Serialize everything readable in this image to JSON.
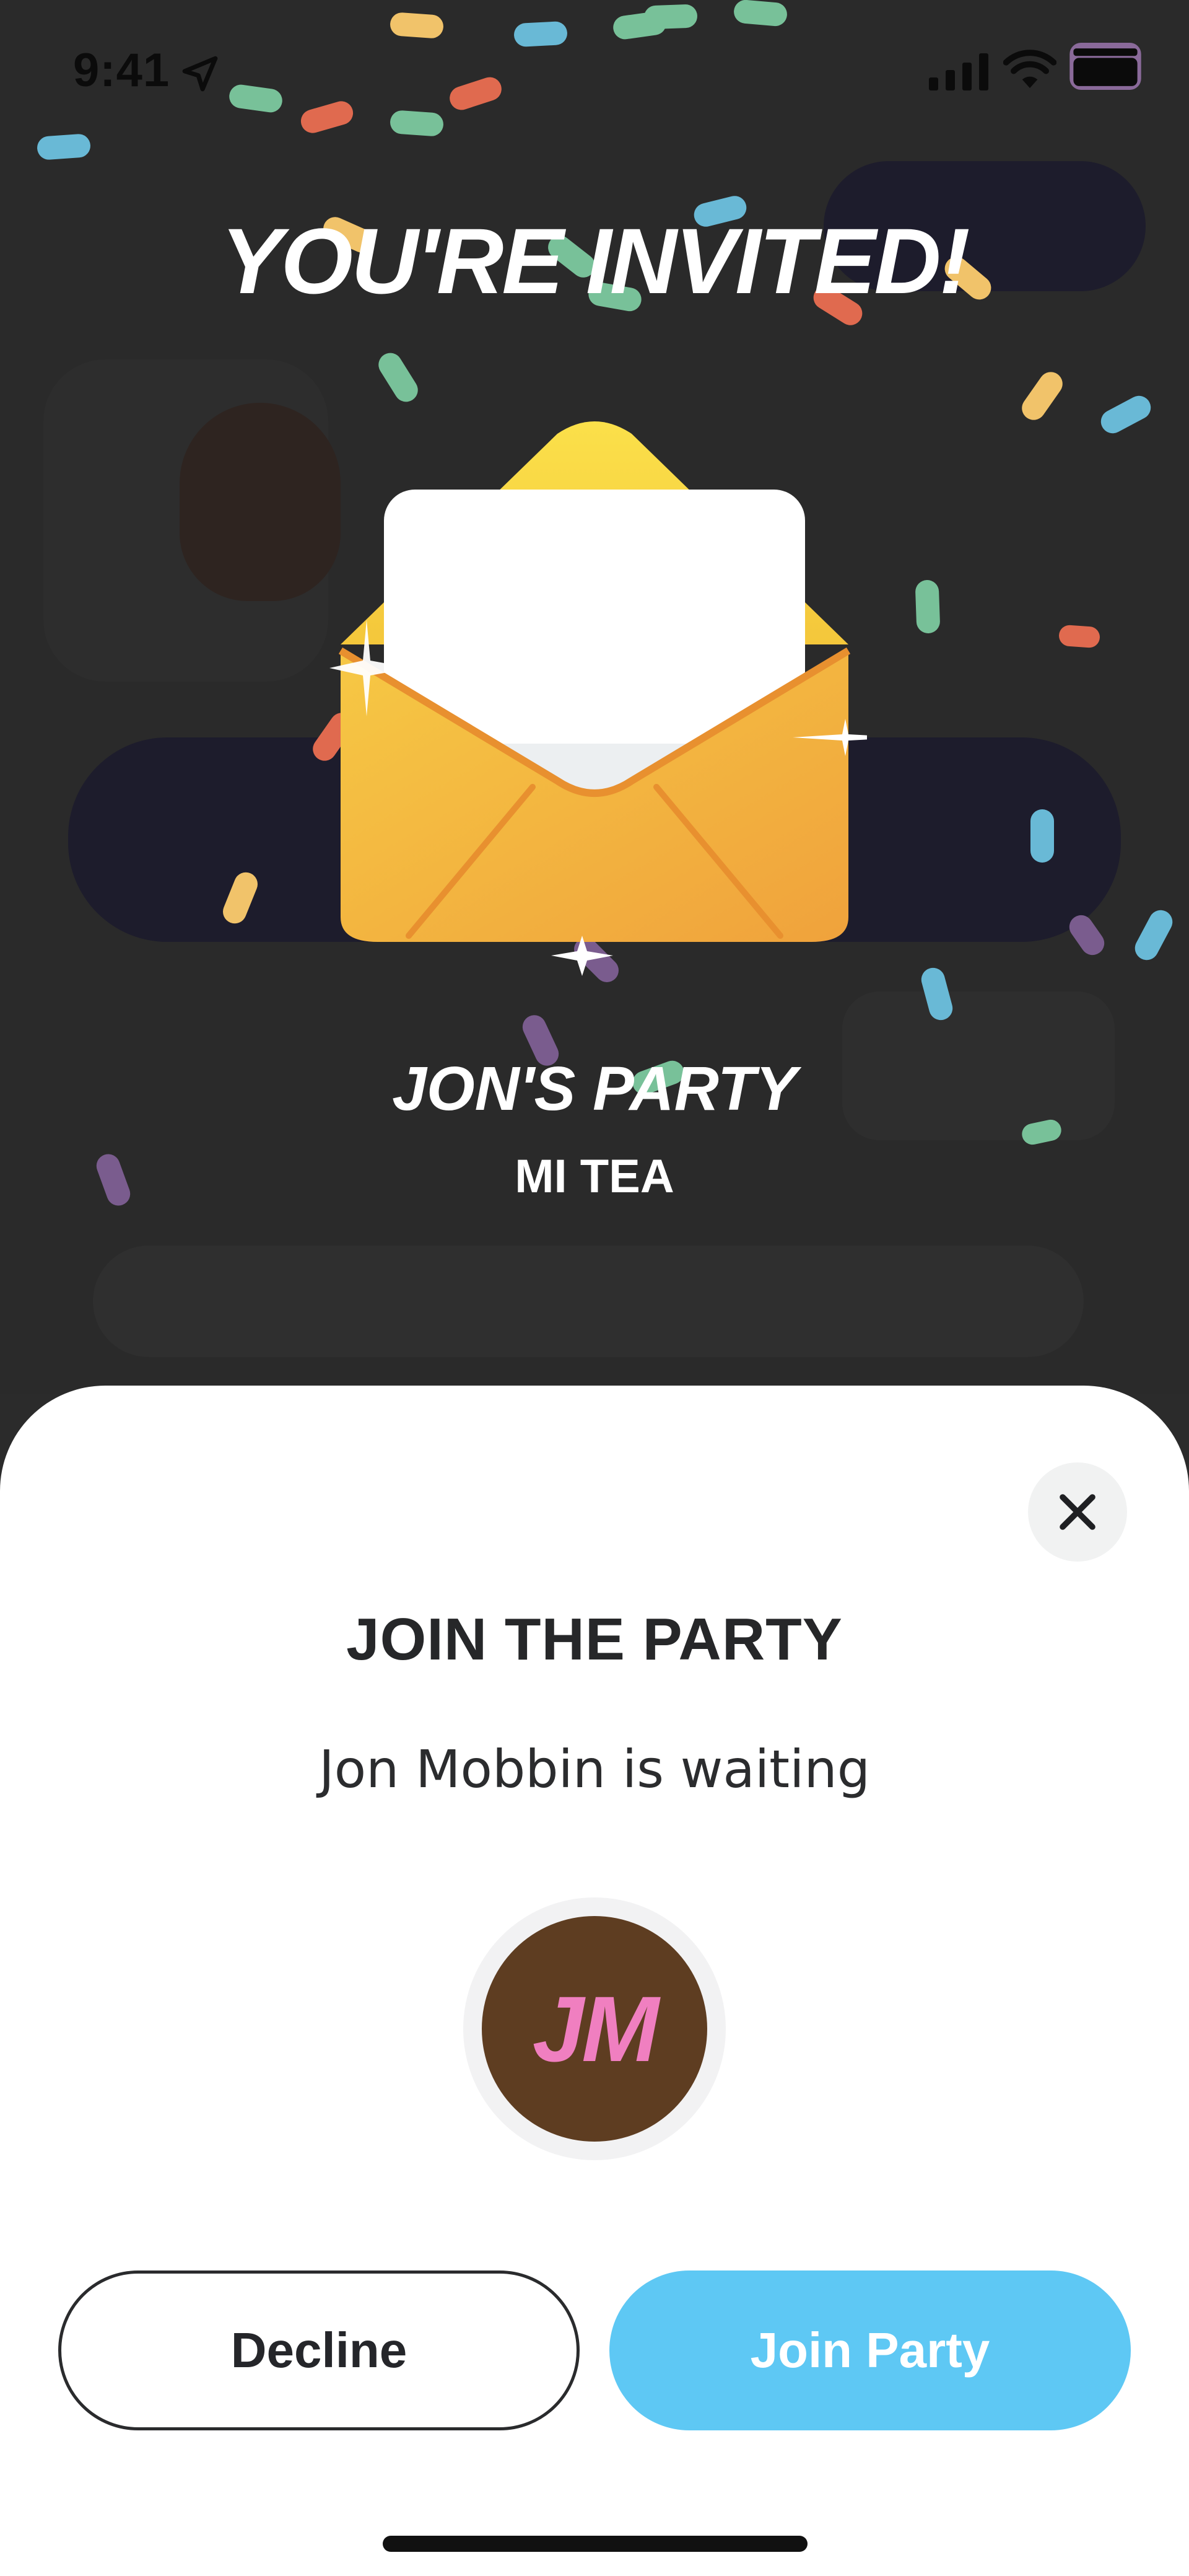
{
  "status_bar": {
    "time": "9:41",
    "icons": [
      "location-arrow-icon",
      "cellular-signal-icon",
      "wifi-icon",
      "battery-icon"
    ]
  },
  "invite_screen": {
    "title": "YOU'RE INVITED!",
    "party_name": "JON'S PARTY",
    "party_subtitle": "MI TEA",
    "illustration": "open-envelope-with-letter",
    "colors": {
      "background": "#2a2a2a",
      "envelope": "#f4c244",
      "letter": "#ffffff"
    }
  },
  "sheet": {
    "title": "JOIN THE PARTY",
    "subtitle": "Jon Mobbin is waiting",
    "close_icon": "close-icon",
    "avatar": {
      "initials": "JM",
      "background": "#5e3d21",
      "text_color": "#f07fc0"
    },
    "decline_label": "Decline",
    "join_label": "Join Party",
    "colors": {
      "join_button": "#5ec8f4",
      "text": "#262729"
    }
  }
}
